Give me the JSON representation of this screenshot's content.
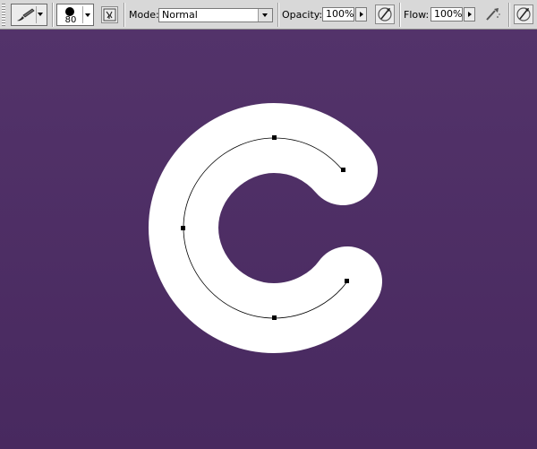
{
  "toolbar": {
    "brush_size": "80",
    "mode_label": "Mode:",
    "mode_value": "Normal",
    "opacity_label": "Opacity:",
    "opacity_value": "100%",
    "flow_label": "Flow:",
    "flow_value": "100%"
  },
  "icons": {
    "tool_preset": "brush-icon",
    "brush_palette": "brush-palette-icon",
    "airbrush": "airbrush-icon",
    "pressure_opacity": "pen-pressure-icon",
    "pressure_size": "pen-pressure-icon"
  },
  "colors": {
    "toolbar_bg": "#d8d8d8",
    "canvas_top": "#53336a",
    "canvas_bottom": "#48295f",
    "shape_fill": "#ffffff",
    "path_stroke": "#000000"
  }
}
